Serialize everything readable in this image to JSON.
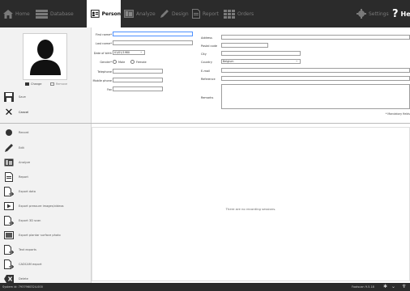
{
  "nav": {
    "home": "Home",
    "database": "Database",
    "person": "Person",
    "analyze": "Analyze",
    "design": "Design",
    "report": "Report",
    "orders": "Orders",
    "settings": "Settings",
    "help": "Help"
  },
  "photo": {
    "change": "Change",
    "remove": "Remove"
  },
  "actions": {
    "save": "Save",
    "cancel": "Cancel"
  },
  "sidebar": {
    "items": [
      {
        "label": "Record",
        "icon": "record-icon"
      },
      {
        "label": "Edit",
        "icon": "pencil-icon"
      },
      {
        "label": "Analyze",
        "icon": "analyze-icon"
      },
      {
        "label": "Report",
        "icon": "report-icon"
      },
      {
        "label": "Export data",
        "icon": "export-data-icon"
      },
      {
        "label": "Export pressure images/videos",
        "icon": "export-video-icon"
      },
      {
        "label": "Export 3D scan",
        "icon": "export-3d-icon"
      },
      {
        "label": "Export plantar surface photo",
        "icon": "export-photo-icon"
      },
      {
        "label": "Text exports",
        "icon": "text-export-icon"
      },
      {
        "label": "CADCAM export",
        "icon": "cadcam-icon"
      },
      {
        "label": "Delete",
        "icon": "delete-icon"
      }
    ]
  },
  "form": {
    "first_name_label": "First name*",
    "first_name_value": "",
    "last_name_label": "Last name*",
    "last_name_value": "",
    "dob_label": "Date of birth",
    "dob_value": "01/01/1980",
    "gender_label": "Gender*",
    "gender_male": "Male",
    "gender_female": "Female",
    "telephone_label": "Telephone",
    "mobile_label": "Mobile phone",
    "fax_label": "Fax",
    "address_label": "Address",
    "postal_label": "Postal code",
    "city_label": "City",
    "country_label": "Country",
    "country_value": "Belgium",
    "email_label": "E-mail",
    "reference_label": "Reference",
    "remarks_label": "Remarks",
    "mandatory_note": "* Mandatory fields"
  },
  "sessions": {
    "empty_message": "There are no recording sessions."
  },
  "status": {
    "system_id": "System id: 7937960324-000",
    "version": "Footscan 9.5.18"
  },
  "colors": {
    "topbar": "#2b2b2b",
    "focus": "#4d90fe",
    "panel": "#f2f2f2"
  }
}
